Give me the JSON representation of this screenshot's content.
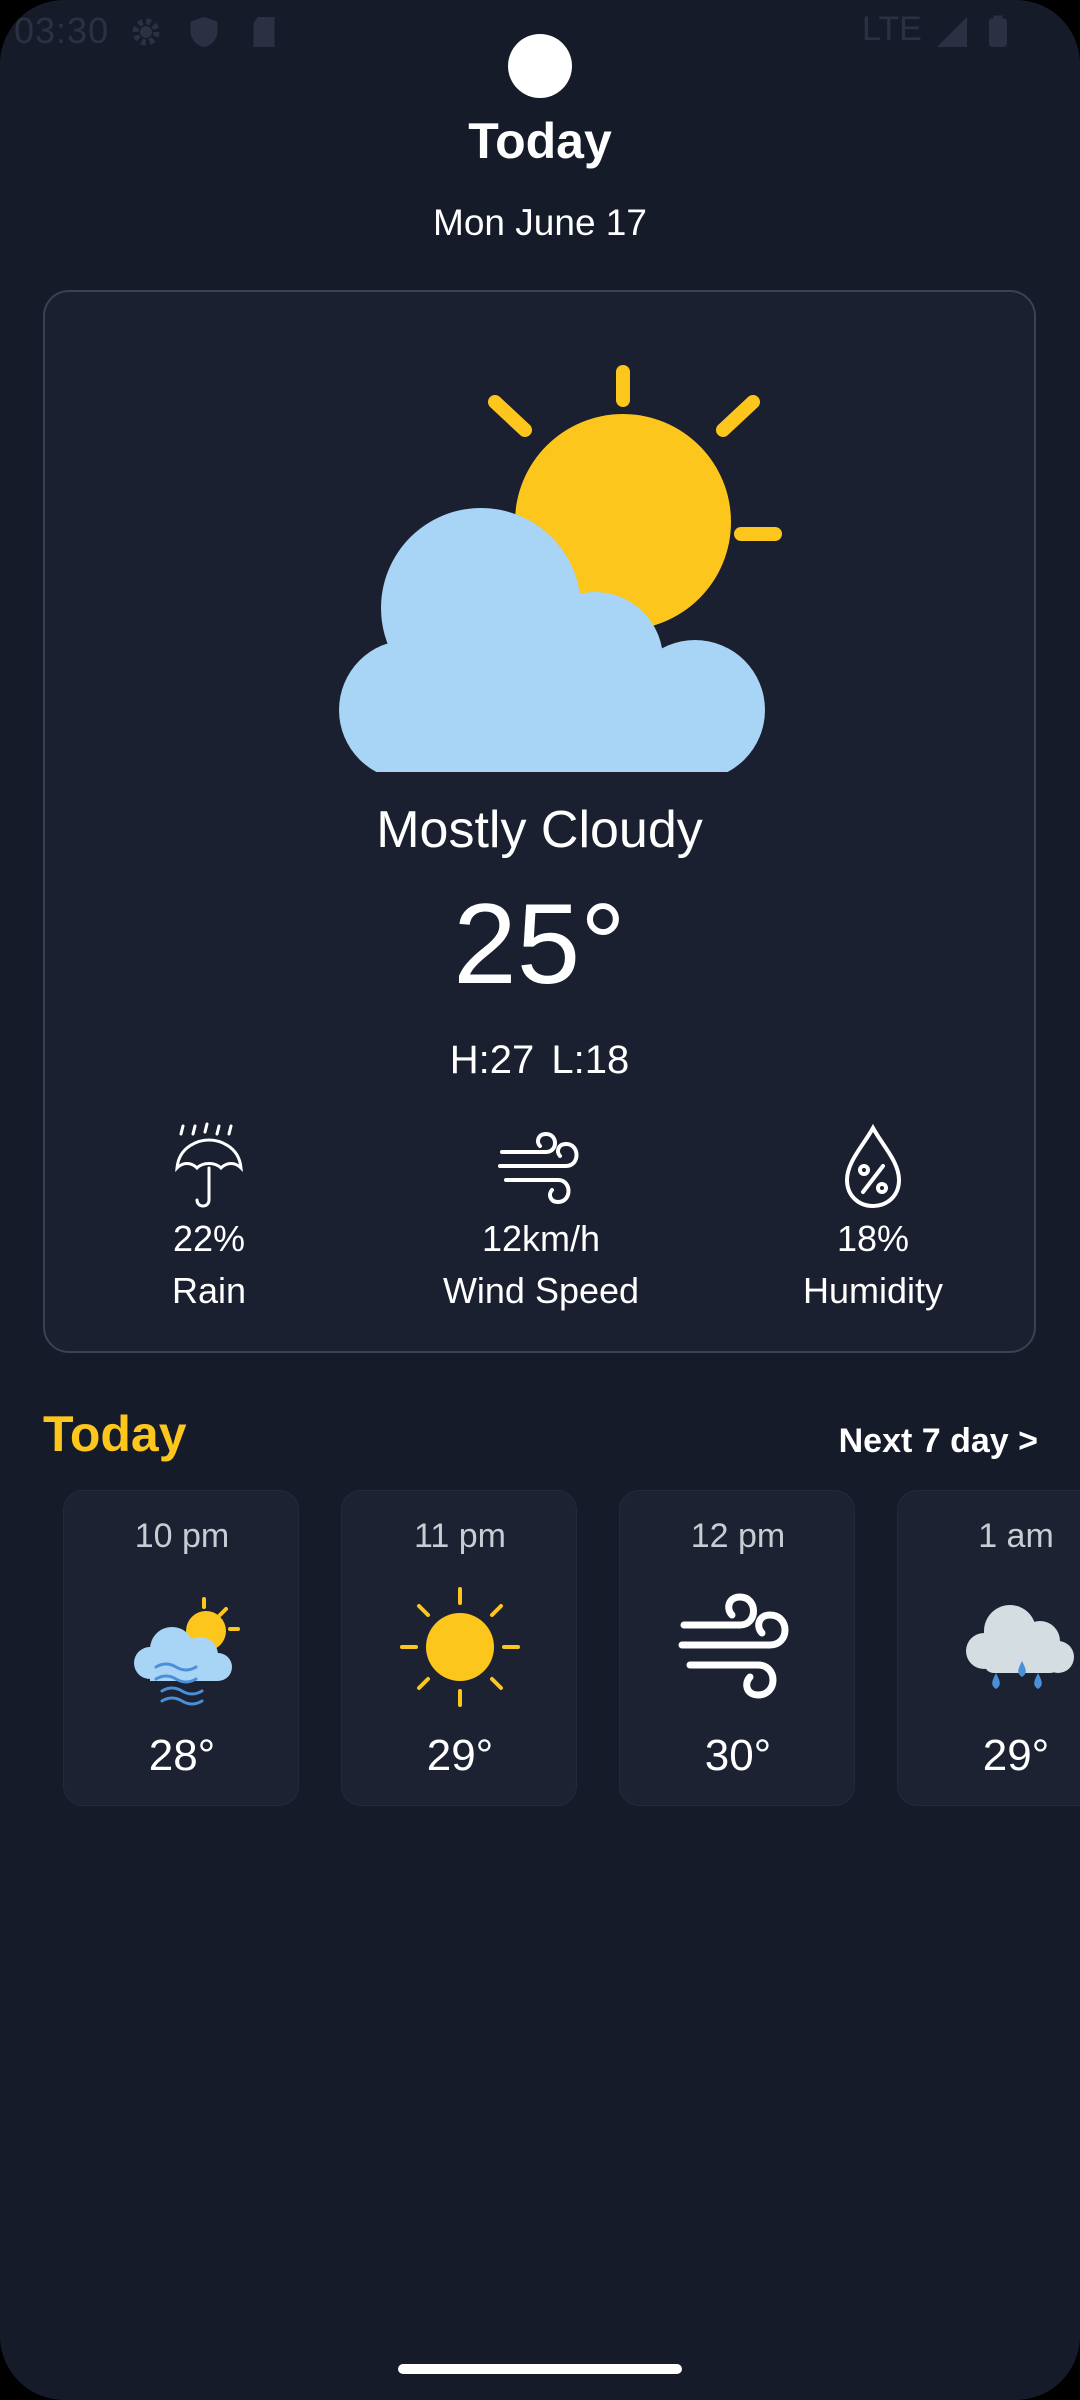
{
  "status_bar": {
    "time": "03:30",
    "network": "LTE",
    "icons": [
      "settings-icon",
      "shield-icon",
      "sd-card-icon",
      "signal-icon",
      "battery-icon"
    ]
  },
  "header": {
    "title": "Today",
    "date": "Mon June 17"
  },
  "current": {
    "icon": "partly-cloudy-icon",
    "condition": "Mostly Cloudy",
    "temperature": "25°",
    "high_low": "H:27  L:18",
    "stats": [
      {
        "icon": "umbrella-rain-icon",
        "value": "22%",
        "label": "Rain"
      },
      {
        "icon": "wind-icon",
        "value": "12km/h",
        "label": "Wind Speed"
      },
      {
        "icon": "humidity-drop-icon",
        "value": "18%",
        "label": "Humidity"
      }
    ]
  },
  "hourly": {
    "title": "Today",
    "next_link": "Next 7 day >",
    "items": [
      {
        "time": "10 pm",
        "icon": "fog-sun-icon",
        "temp": "28°"
      },
      {
        "time": "11 pm",
        "icon": "sun-icon",
        "temp": "29°"
      },
      {
        "time": "12 pm",
        "icon": "wind-icon",
        "temp": "30°"
      },
      {
        "time": "1 am",
        "icon": "rain-cloud-icon",
        "temp": "29°"
      }
    ]
  },
  "colors": {
    "background": "#161b2a",
    "card": "#1a2030",
    "accent": "#fcc61d",
    "cloud": "#a8d4f5"
  }
}
